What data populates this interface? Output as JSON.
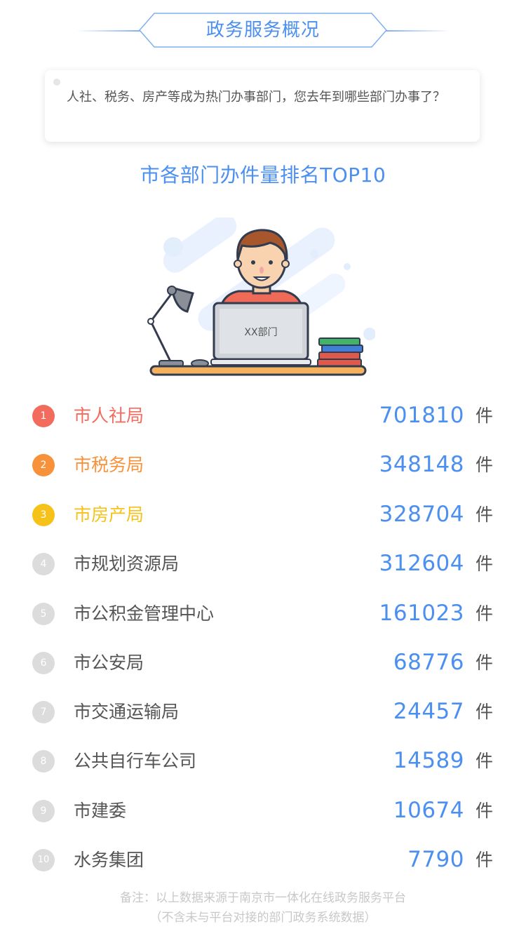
{
  "header": {
    "title": "政务服务概况"
  },
  "bubble": {
    "text": "人社、税务、房产等成为热门办事部门，您去年到哪些部门办事了？"
  },
  "section": {
    "title": "市各部门办件量排名TOP10"
  },
  "illustration": {
    "screen_label": "XX部门"
  },
  "ranking": {
    "unit": "件",
    "items": [
      {
        "rank": "1",
        "name": "市人社局",
        "value": "701810",
        "color": "#f36b5c"
      },
      {
        "rank": "2",
        "name": "市税务局",
        "value": "348148",
        "color": "#f7923a"
      },
      {
        "rank": "3",
        "name": "市房产局",
        "value": "328704",
        "color": "#f6c21a"
      },
      {
        "rank": "4",
        "name": "市规划资源局",
        "value": "312604",
        "color": "#dcdcdc"
      },
      {
        "rank": "5",
        "name": "市公积金管理中心",
        "value": "161023",
        "color": "#dcdcdc"
      },
      {
        "rank": "6",
        "name": "市公安局",
        "value": "68776",
        "color": "#dcdcdc"
      },
      {
        "rank": "7",
        "name": "市交通运输局",
        "value": "24457",
        "color": "#dcdcdc"
      },
      {
        "rank": "8",
        "name": "公共自行车公司",
        "value": "14589",
        "color": "#dcdcdc"
      },
      {
        "rank": "9",
        "name": "市建委",
        "value": "10674",
        "color": "#dcdcdc"
      },
      {
        "rank": "10",
        "name": "水务集团",
        "value": "7790",
        "color": "#dcdcdc"
      }
    ]
  },
  "footnote": {
    "line1": "备注：以上数据来源于南京市一体化在线政务服务平台",
    "line2": "（不含未与平台对接的部门政务系统数据）"
  },
  "colors": {
    "accent_blue": "#4b8ff0",
    "rank1": "#f36b5c",
    "rank2": "#f7923a",
    "rank3": "#f6c21a",
    "rank_default": "#dcdcdc"
  }
}
